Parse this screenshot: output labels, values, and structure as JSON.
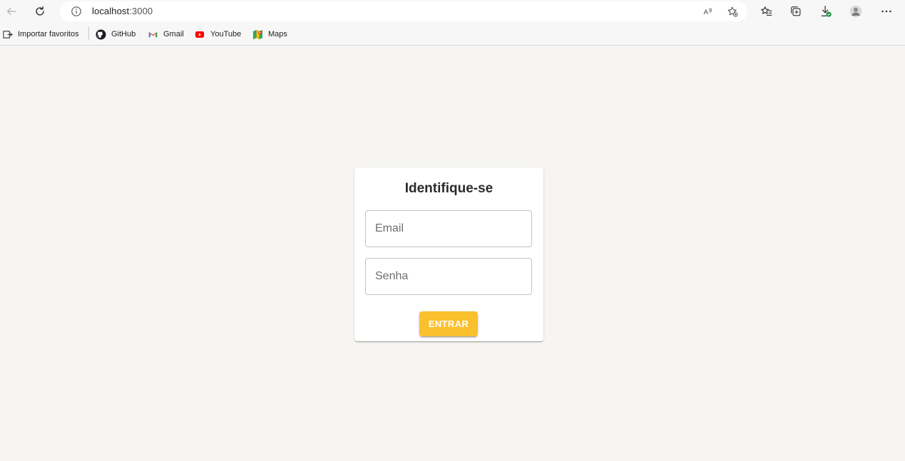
{
  "browser": {
    "url_host": "localhost",
    "url_port": ":3000",
    "bookmarks": {
      "import": "Importar favoritos",
      "github": "GitHub",
      "gmail": "Gmail",
      "youtube": "YouTube",
      "maps": "Maps"
    },
    "icons": [
      "back-icon",
      "refresh-icon",
      "info-icon",
      "read-aloud-icon",
      "add-favorite-icon",
      "favorites-icon",
      "collections-icon",
      "downloads-icon",
      "profile-avatar",
      "more-icon"
    ]
  },
  "login": {
    "title": "Identifique-se",
    "email_placeholder": "Email",
    "password_placeholder": "Senha",
    "submit_label": "ENTRAR"
  },
  "colors": {
    "page_background": "#f6f5f2",
    "button": "#fbc02d",
    "button_text": "#ffffff",
    "card": "#ffffff"
  }
}
